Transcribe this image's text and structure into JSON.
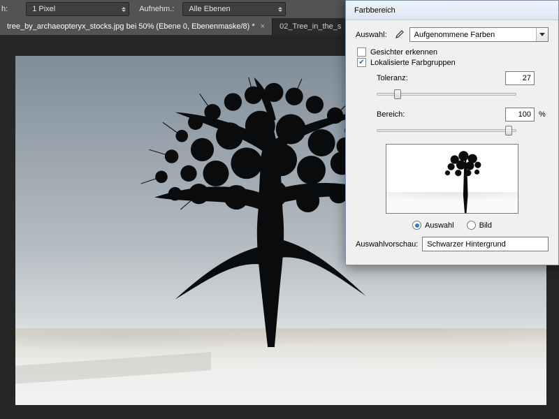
{
  "optionsbar": {
    "label_left_trunc": "h:",
    "pixel_select": "1 Pixel",
    "aufnehmen_label": "Aufnehm.:",
    "layers_select": "Alle Ebenen"
  },
  "tabs": [
    {
      "title": "tree_by_archaeopteryx_stocks.jpg bei 50% (Ebene 0, Ebenenmaske/8) *",
      "active": true
    },
    {
      "title": "02_Tree_in_the_s",
      "active": false
    }
  ],
  "dialog": {
    "title": "Farbbereich",
    "auswahl_label": "Auswahl:",
    "auswahl_value": "Aufgenommene Farben",
    "detect_faces_label": "Gesichter erkennen",
    "detect_faces_checked": false,
    "localized_label": "Lokalisierte Farbgruppen",
    "localized_checked": true,
    "tolerance_label": "Toleranz:",
    "tolerance_value": "27",
    "range_label": "Bereich:",
    "range_value": "100",
    "range_unit": "%",
    "radio_selection_label": "Auswahl",
    "radio_image_label": "Bild",
    "radio_selected": "selection",
    "vorschau_label": "Auswahlvorschau:",
    "vorschau_value": "Schwarzer Hintergrund"
  },
  "sliders": {
    "tolerance_pct": 13,
    "range_pct": 97
  }
}
